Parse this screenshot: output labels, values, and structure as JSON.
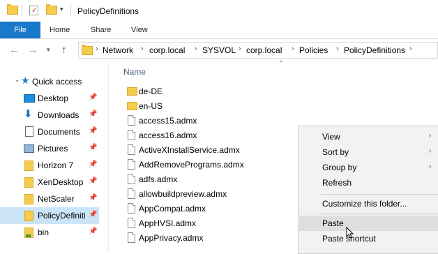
{
  "window": {
    "title": "PolicyDefinitions"
  },
  "ribbon": {
    "tabs": [
      "File",
      "Home",
      "Share",
      "View"
    ]
  },
  "address": {
    "crumbs": [
      "Network",
      "corp.local",
      "SYSVOL",
      "corp.local",
      "Policies",
      "PolicyDefinitions"
    ]
  },
  "sidebar": {
    "items": [
      {
        "label": "Quick access",
        "icon": "star-icon"
      },
      {
        "label": "Desktop",
        "icon": "desktop-icon"
      },
      {
        "label": "Downloads",
        "icon": "download-icon"
      },
      {
        "label": "Documents",
        "icon": "documents-icon"
      },
      {
        "label": "Pictures",
        "icon": "pictures-icon"
      },
      {
        "label": "Horizon 7",
        "icon": "folder-icon"
      },
      {
        "label": "XenDesktop",
        "icon": "folder-icon"
      },
      {
        "label": "NetScaler",
        "icon": "folder-icon"
      },
      {
        "label": "PolicyDefiniti",
        "icon": "folder-icon",
        "selected": true
      },
      {
        "label": "bin",
        "icon": "folder-icon"
      }
    ]
  },
  "list": {
    "header": "Name",
    "files": [
      {
        "name": "de-DE",
        "type": "folder"
      },
      {
        "name": "en-US",
        "type": "folder"
      },
      {
        "name": "access15.admx",
        "type": "file"
      },
      {
        "name": "access16.admx",
        "type": "file"
      },
      {
        "name": "ActiveXInstallService.admx",
        "type": "file"
      },
      {
        "name": "AddRemovePrograms.admx",
        "type": "file"
      },
      {
        "name": "adfs.admx",
        "type": "file"
      },
      {
        "name": "allowbuildpreview.admx",
        "type": "file"
      },
      {
        "name": "AppCompat.admx",
        "type": "file"
      },
      {
        "name": "AppHVSI.admx",
        "type": "file"
      },
      {
        "name": "AppPrivacy.admx",
        "type": "file"
      }
    ]
  },
  "context_menu": {
    "items": [
      "View",
      "Sort by",
      "Group by",
      "Refresh",
      "Customize this folder...",
      "Paste",
      "Paste shortcut"
    ],
    "highlighted": "Paste"
  }
}
